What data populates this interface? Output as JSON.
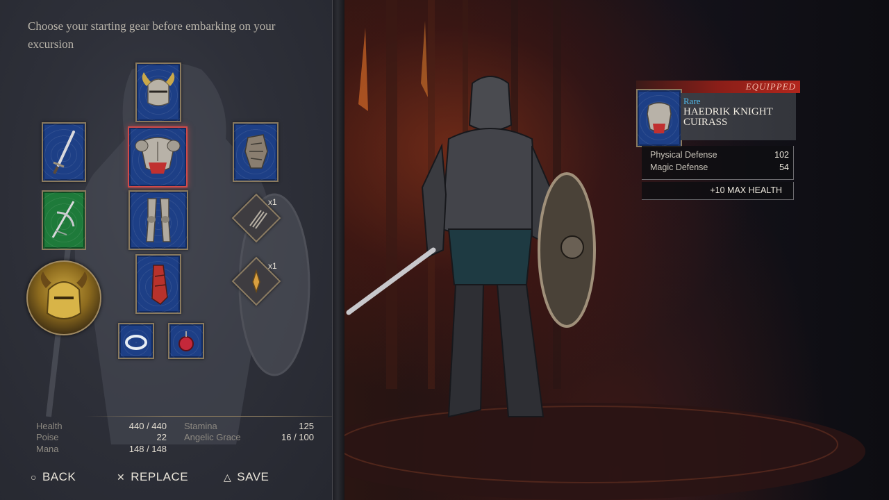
{
  "intro": "Choose your starting gear before embarking on your excursion",
  "gear_slots": [
    {
      "name": "helmet-slot",
      "icon": "horned-helmet-icon"
    },
    {
      "name": "weapon-slot",
      "icon": "sword-icon"
    },
    {
      "name": "chest-slot",
      "icon": "cuirass-icon",
      "selected": true
    },
    {
      "name": "gauntlet-slot",
      "icon": "gauntlet-icon"
    },
    {
      "name": "offhand-slot",
      "icon": "crossbow-icon"
    },
    {
      "name": "legs-slot",
      "icon": "greaves-icon"
    },
    {
      "name": "arms-slot",
      "icon": "bracer-icon"
    },
    {
      "name": "ring-slot",
      "icon": "ring-icon"
    },
    {
      "name": "amulet-slot",
      "icon": "red-gem-icon"
    }
  ],
  "consumables": [
    {
      "icon": "throwing-knives-icon",
      "qty": "x1"
    },
    {
      "icon": "flask-icon",
      "qty": "x1"
    }
  ],
  "character_medallion": {
    "icon": "golden-helm-medallion-icon"
  },
  "stats": {
    "health_label": "Health",
    "health_value": "440 / 440",
    "poise_label": "Poise",
    "poise_value": "22",
    "mana_label": "Mana",
    "mana_value": "148 / 148",
    "stamina_label": "Stamina",
    "stamina_value": "125",
    "grace_label": "Angelic Grace",
    "grace_value": "16 / 100"
  },
  "footer": {
    "back": {
      "glyph": "○",
      "label": "BACK"
    },
    "replace": {
      "glyph": "✕",
      "label": "REPLACE"
    },
    "save": {
      "glyph": "△",
      "label": "SAVE"
    }
  },
  "tooltip": {
    "status": "EQUIPPED",
    "rarity": "Rare",
    "name": "HAEDRIK KNIGHT CUIRASS",
    "stats": [
      {
        "label": "Physical Defense",
        "value": "102"
      },
      {
        "label": "Magic Defense",
        "value": "54"
      }
    ],
    "bonus": "+10 MAX HEALTH"
  },
  "colors": {
    "rare": "#4fb8e8",
    "equipped_banner": "#b2261c",
    "selected_border": "#d04a4a",
    "slot_blue": "#1d3f86"
  }
}
